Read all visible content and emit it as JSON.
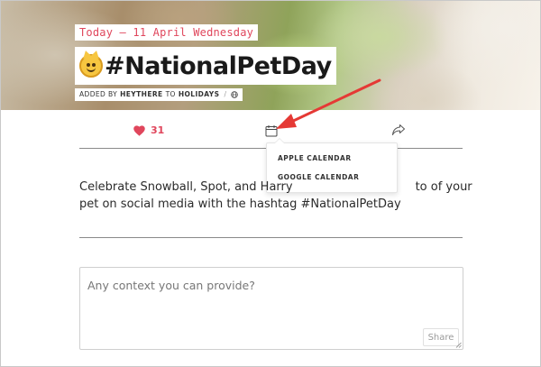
{
  "hero": {
    "date_label": "Today — 11 April Wednesday",
    "title": "#NationalPetDay",
    "title_emoji": "grinning-cat-emoji",
    "added_by_prefix": "ADDED BY",
    "added_by_user": "HEYTHERE",
    "added_to_text": "TO",
    "added_to_collection": "HOLIDAYS",
    "separator": "/"
  },
  "actions": {
    "like_icon": "heart-icon",
    "like_count": "31",
    "calendar_icon": "calendar-icon",
    "share_icon": "share-arrow-icon"
  },
  "calendar_menu": {
    "items": [
      "APPLE CALENDAR",
      "GOOGLE CALENDAR"
    ]
  },
  "description": {
    "line1": "Celebrate Snowball, Spot, and Harry",
    "line1_end": "to of your",
    "line2": "pet on social media with the hashtag #NationalPetDay"
  },
  "context": {
    "placeholder": "Any context you can provide?",
    "share_label": "Share"
  },
  "colors": {
    "accent": "#e0465c",
    "annotation_arrow": "#e53935"
  }
}
